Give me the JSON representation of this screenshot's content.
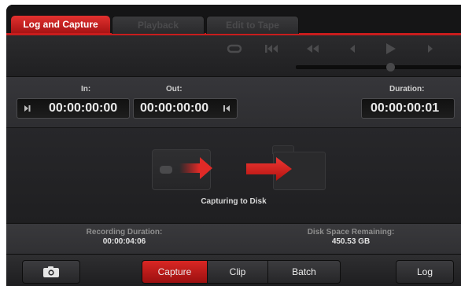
{
  "tabs": [
    {
      "label": "Log and Capture"
    },
    {
      "label": "Playback"
    },
    {
      "label": "Edit to Tape"
    }
  ],
  "timecodes": {
    "in_label": "In:",
    "in_value": "00:00:00:00",
    "out_label": "Out:",
    "out_value": "00:00:00:00",
    "duration_label": "Duration:",
    "duration_value": "00:00:00:01"
  },
  "capture": {
    "status": "Capturing to Disk"
  },
  "info": {
    "recording_label": "Recording Duration:",
    "recording_value": "00:00:04:06",
    "disk_label": "Disk Space Remaining:",
    "disk_value": "450.53 GB"
  },
  "bottom": {
    "capture_label": "Capture",
    "clip_label": "Clip",
    "batch_label": "Batch",
    "log_label": "Log",
    "active_mode": "Capture"
  },
  "colors": {
    "accent": "#d12520",
    "background": "#1d1d1f"
  },
  "icons": [
    "loop-icon",
    "skip-back-icon",
    "rewind-icon",
    "step-back-icon",
    "play-icon",
    "step-forward-icon",
    "mark-in-icon",
    "mark-out-icon",
    "tape-icon",
    "arrow-right-icon",
    "folder-icon",
    "camera-icon"
  ]
}
